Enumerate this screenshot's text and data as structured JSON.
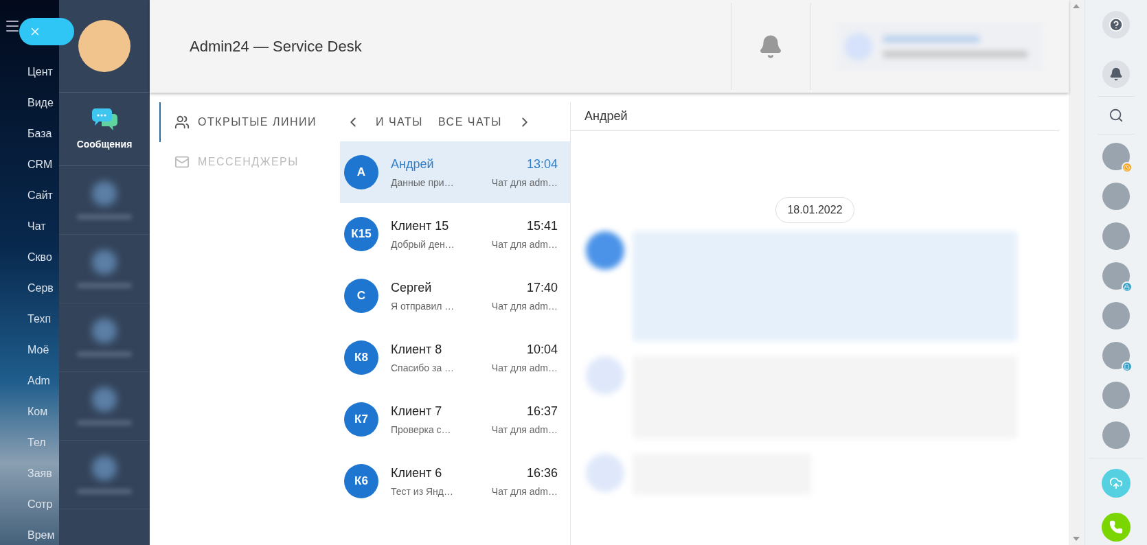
{
  "background_menu": {
    "items": [
      "Цент",
      "Виде",
      "База",
      "CRM",
      "Сайт",
      "Чат",
      "Скво",
      "Серв",
      "Техп",
      "Моё",
      "Adm",
      "Ком",
      "Тел",
      "Заяв",
      "Сотр",
      "Врем"
    ]
  },
  "sidebar": {
    "items": [
      {
        "label": "Сообщения",
        "selected": true
      }
    ]
  },
  "header": {
    "title": "Admin24 — Service Desk"
  },
  "tabs": [
    {
      "label": "ОТКРЫТЫЕ ЛИНИИ",
      "selected": true,
      "kind": "people"
    },
    {
      "label": "МЕССЕНДЖЕРЫ",
      "selected": false,
      "kind": "mail"
    }
  ],
  "filters": [
    "И ЧАТЫ",
    "ВСЕ ЧАТЫ"
  ],
  "chats": [
    {
      "initials": "А",
      "name": "Андрей",
      "time": "13:04",
      "preview": "Данные при…",
      "channel": "Чат для adm…",
      "selected": true
    },
    {
      "initials": "К15",
      "name": "Клиент 15",
      "time": "15:41",
      "preview": "Добрый ден…",
      "channel": "Чат для adm…",
      "selected": false
    },
    {
      "initials": "С",
      "name": "Сергей",
      "time": "17:40",
      "preview": "Я отправил …",
      "channel": "Чат для adm…",
      "selected": false
    },
    {
      "initials": "К8",
      "name": "Клиент 8",
      "time": "10:04",
      "preview": "Спасибо за …",
      "channel": "Чат для adm…",
      "selected": false
    },
    {
      "initials": "К7",
      "name": "Клиент 7",
      "time": "16:37",
      "preview": "Проверка с…",
      "channel": "Чат для adm…",
      "selected": false
    },
    {
      "initials": "К6",
      "name": "Клиент 6",
      "time": "16:36",
      "preview": "Тест из Янд…",
      "channel": "Чат для adm…",
      "selected": false
    }
  ],
  "conversation": {
    "title": "Андрей",
    "date": "18.01.2022"
  },
  "contacts": [
    {
      "kind": "clock"
    },
    {
      "kind": "plain"
    },
    {
      "kind": "plain"
    },
    {
      "kind": "lock"
    },
    {
      "kind": "plain"
    },
    {
      "kind": "phone"
    },
    {
      "kind": "plain"
    },
    {
      "kind": "plain"
    }
  ]
}
